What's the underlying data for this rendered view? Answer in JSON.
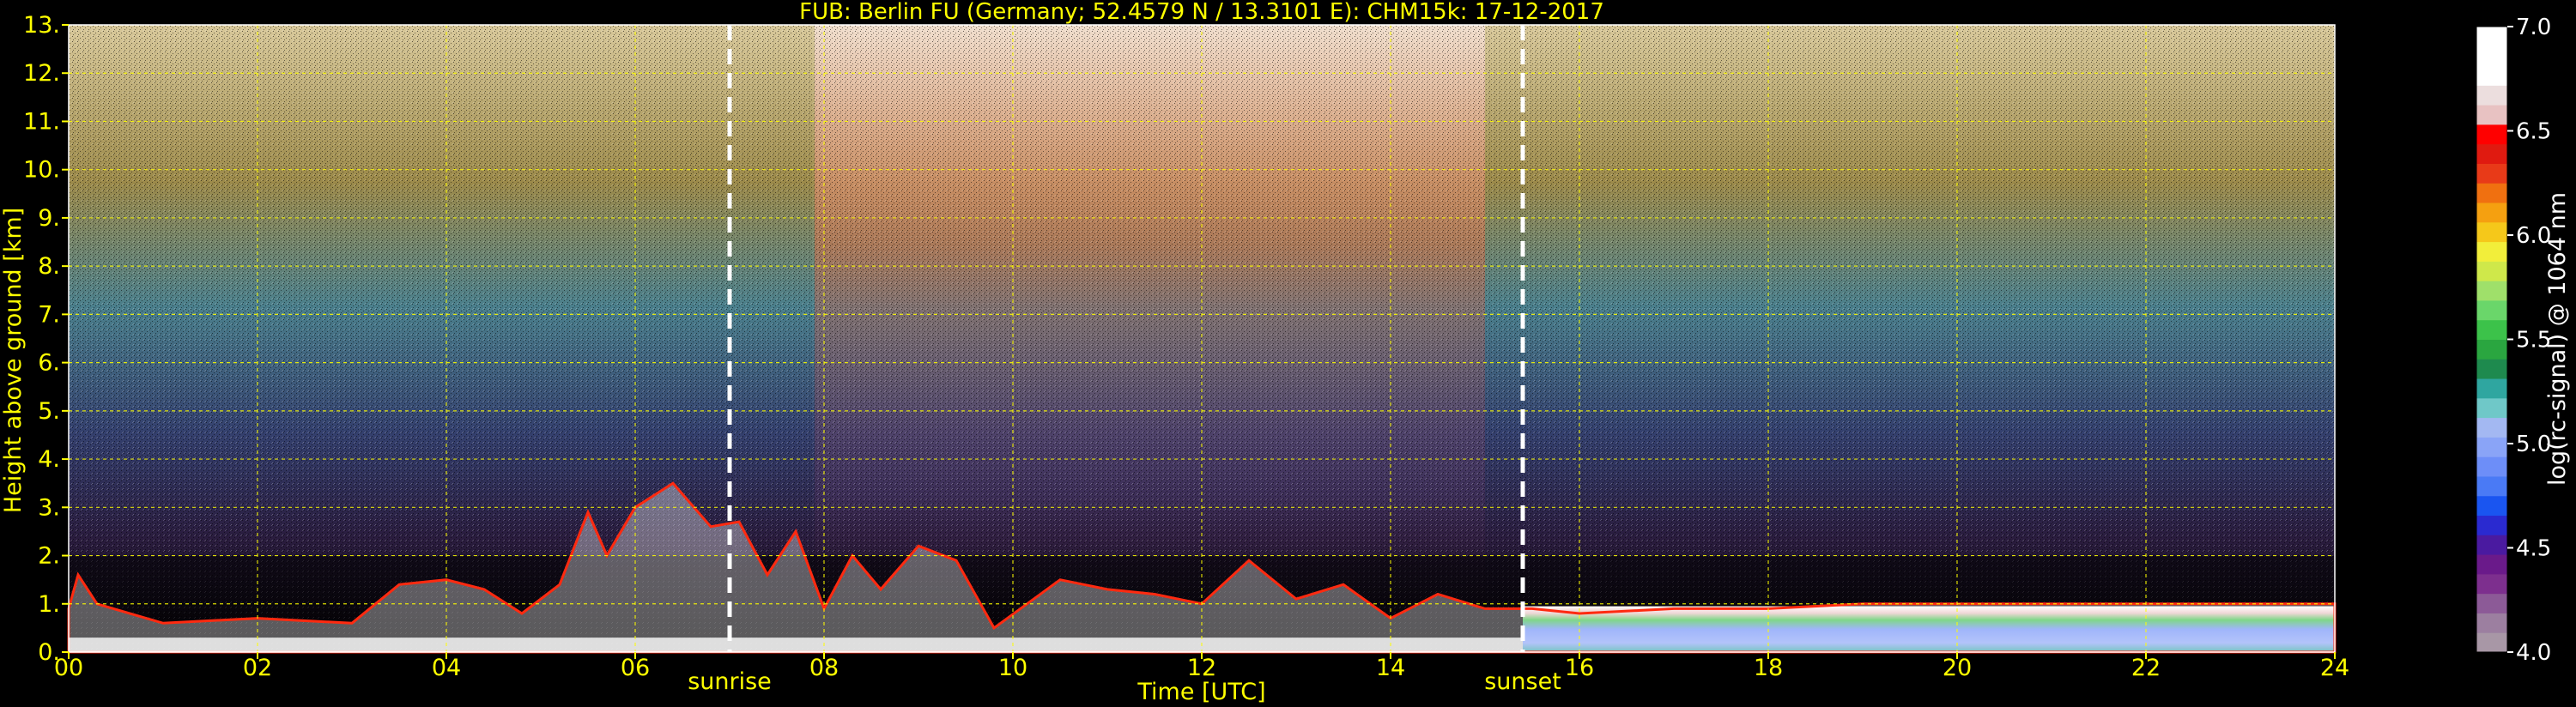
{
  "chart_data": {
    "type": "heatmap",
    "title": "FUB: Berlin FU (Germany; 52.4579 N / 13.3101 E):    CHM15k: 17-12-2017",
    "xlabel": "Time [UTC]",
    "ylabel": "Height above ground [km]",
    "colorbar_label": "log(rc-signal) @ 1064 nm",
    "xlim": [
      0,
      24
    ],
    "ylim": [
      0,
      13
    ],
    "x_ticks": [
      0,
      2,
      4,
      6,
      8,
      10,
      12,
      14,
      16,
      18,
      20,
      22,
      24
    ],
    "x_tick_labels": [
      "00",
      "02",
      "04",
      "06",
      "08",
      "10",
      "12",
      "14",
      "16",
      "18",
      "20",
      "22",
      "24"
    ],
    "y_ticks": [
      0,
      1,
      2,
      3,
      4,
      5,
      6,
      7,
      8,
      9,
      10,
      11,
      12,
      13
    ],
    "y_tick_labels": [
      "0.",
      "1.",
      "2.",
      "3.",
      "4.",
      "5.",
      "6.",
      "7.",
      "8.",
      "9.",
      "10.",
      "11.",
      "12.",
      "13."
    ],
    "grid": true,
    "colorbar_range": [
      4.0,
      7.0
    ],
    "colorbar_ticks": [
      4.0,
      4.5,
      5.0,
      5.5,
      6.0,
      6.5,
      7.0
    ],
    "colorbar_tick_labels": [
      "4.0",
      "4.5",
      "5.0",
      "5.5",
      "6.0",
      "6.5",
      "7.0"
    ],
    "colorbar_colors": [
      "#a897a6",
      "#9c7fa0",
      "#8c5a97",
      "#7d2f8e",
      "#6a1a8a",
      "#4a1aa0",
      "#2a2ad0",
      "#1a55f0",
      "#4a7af5",
      "#6d8ef8",
      "#8aa4f7",
      "#a3b8f2",
      "#6fc8c8",
      "#2fa6a0",
      "#1e8a4e",
      "#2aa640",
      "#3cc24a",
      "#6ad66a",
      "#9fe06a",
      "#cfe84a",
      "#f2ee3a",
      "#f5c81a",
      "#f5a010",
      "#f07010",
      "#e83a18",
      "#e01a10",
      "#ff0000",
      "#e8c2c2",
      "#ecdede",
      "#ffffff",
      "#ffffff",
      "#ffffff"
    ],
    "events": [
      {
        "label": "sunrise",
        "time": 7.0
      },
      {
        "label": "sunset",
        "time": 15.4
      }
    ],
    "cloud_top_km": [
      [
        0.0,
        0.9
      ],
      [
        0.1,
        1.6
      ],
      [
        0.3,
        1.0
      ],
      [
        1.0,
        0.6
      ],
      [
        2.0,
        0.7
      ],
      [
        3.0,
        0.6
      ],
      [
        3.5,
        1.4
      ],
      [
        4.0,
        1.5
      ],
      [
        4.4,
        1.3
      ],
      [
        4.8,
        0.8
      ],
      [
        5.2,
        1.4
      ],
      [
        5.5,
        2.9
      ],
      [
        5.7,
        2.0
      ],
      [
        6.0,
        3.0
      ],
      [
        6.4,
        3.5
      ],
      [
        6.8,
        2.6
      ],
      [
        7.1,
        2.7
      ],
      [
        7.4,
        1.6
      ],
      [
        7.7,
        2.5
      ],
      [
        8.0,
        0.9
      ],
      [
        8.3,
        2.0
      ],
      [
        8.6,
        1.3
      ],
      [
        9.0,
        2.2
      ],
      [
        9.4,
        1.9
      ],
      [
        9.8,
        0.5
      ],
      [
        10.5,
        1.5
      ],
      [
        11.0,
        1.3
      ],
      [
        11.5,
        1.2
      ],
      [
        12.0,
        1.0
      ],
      [
        12.5,
        1.9
      ],
      [
        13.0,
        1.1
      ],
      [
        13.5,
        1.4
      ],
      [
        14.0,
        0.7
      ],
      [
        14.5,
        1.2
      ],
      [
        15.0,
        0.9
      ],
      [
        15.5,
        0.9
      ],
      [
        16.0,
        0.8
      ],
      [
        17.0,
        0.9
      ],
      [
        18.0,
        0.9
      ],
      [
        19.0,
        1.0
      ],
      [
        20.0,
        1.0
      ],
      [
        21.0,
        1.0
      ],
      [
        22.0,
        1.0
      ],
      [
        23.0,
        1.0
      ],
      [
        24.0,
        1.0
      ]
    ],
    "aerosol_layer_base_km": [
      [
        0.0,
        0.0
      ],
      [
        8.0,
        0.0
      ],
      [
        16.5,
        0.05
      ],
      [
        24.0,
        0.05
      ]
    ],
    "colors": {
      "background": "#000000",
      "text": "#ffff00",
      "grid": "#ffff00",
      "event_line": "#ffffff",
      "colorbar_text": "#ffffff"
    }
  }
}
